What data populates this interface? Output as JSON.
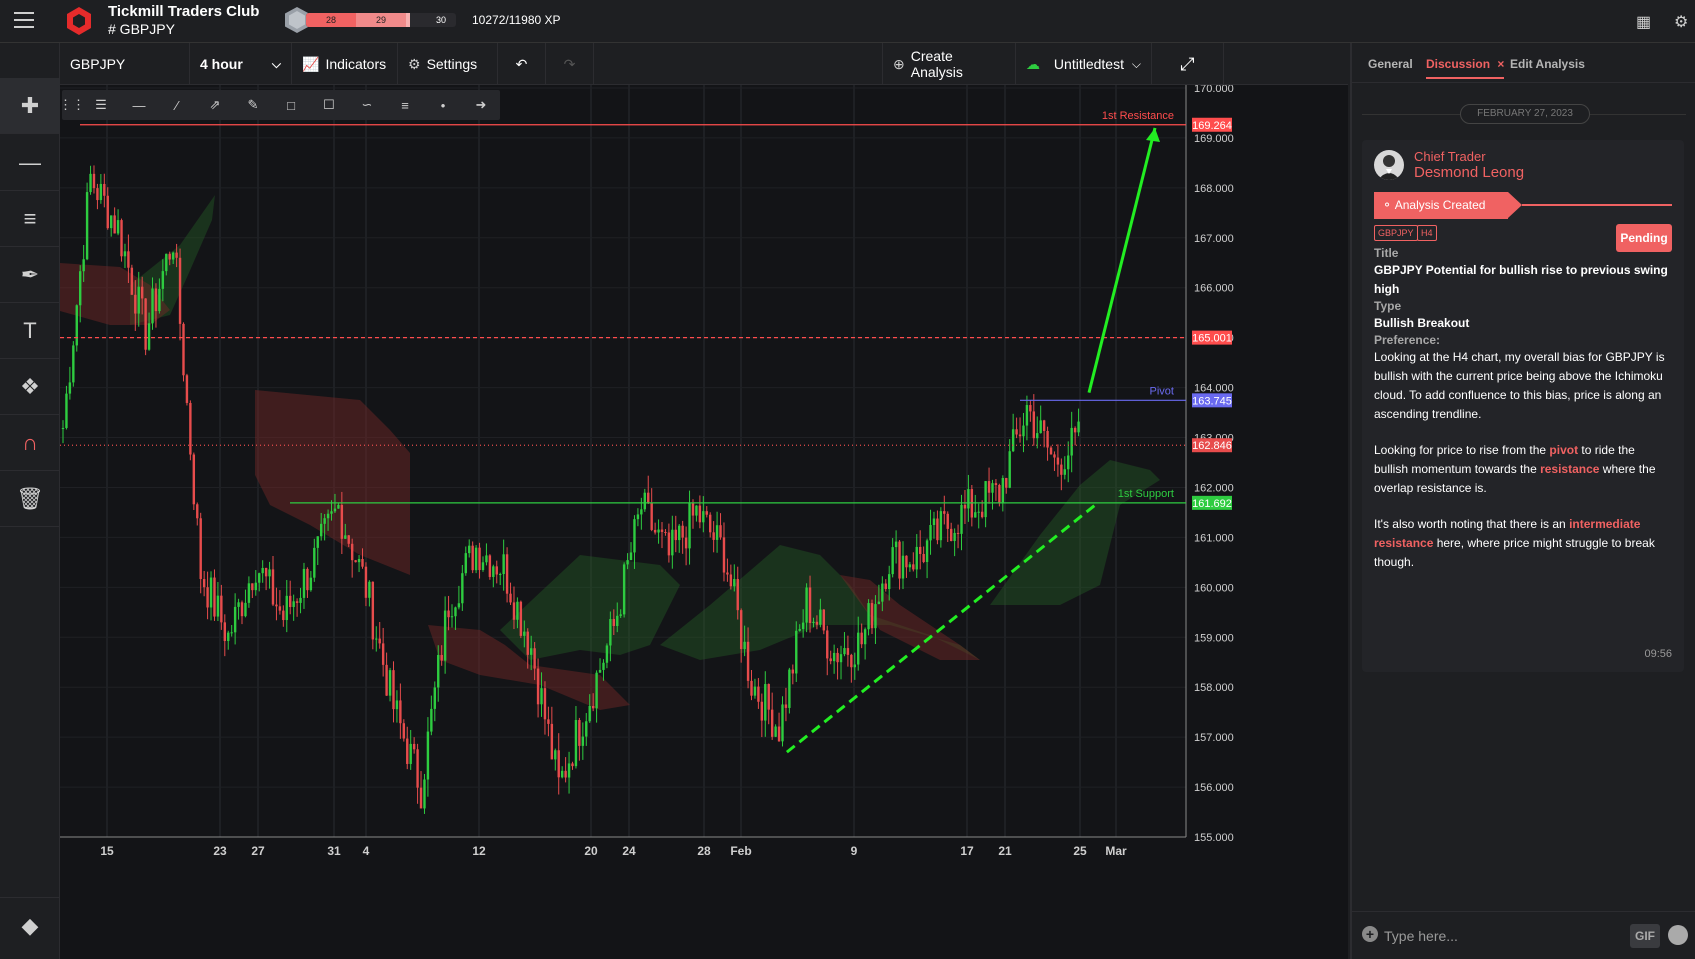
{
  "topbar": {
    "club_title": "Tickmill Traders Club",
    "club_sub": "# GBPJPY",
    "xp_seg1": "28",
    "xp_seg2": "29",
    "xp_seg3": "30",
    "xp_text": "10272/11980 XP",
    "xp_progress": 0.857
  },
  "chart_header": {
    "symbol": "GBPJPY",
    "interval": "4 hour",
    "indicators": "Indicators",
    "settings": "Settings",
    "create_analysis": "Create Analysis",
    "layout_name": "Untitledtest"
  },
  "chart_data": {
    "type": "candlestick",
    "symbol": "GBPJPY",
    "interval": "4 hour",
    "ylim": [
      155.0,
      170.0
    ],
    "y_ticks": [
      "170.000",
      "169.000",
      "168.000",
      "167.000",
      "166.000",
      "165.000",
      "164.000",
      "163.000",
      "162.000",
      "161.000",
      "160.000",
      "159.000",
      "158.000",
      "157.000",
      "156.000",
      "155.000"
    ],
    "x_ticks": [
      "15",
      "23",
      "27",
      "31",
      "4",
      "12",
      "20",
      "24",
      "28",
      "Feb",
      "9",
      "17",
      "21",
      "25",
      "Mar"
    ],
    "levels": [
      {
        "label": "1st Resistance",
        "value": "169.264",
        "color": "#ff4d4d",
        "style": "solid"
      },
      {
        "label": "",
        "value": "165.001",
        "color": "#ff4d4d",
        "style": "dashed"
      },
      {
        "label": "Pivot",
        "value": "163.745",
        "color": "#6a6af0",
        "style": "solid"
      },
      {
        "label": "",
        "value": "162.846",
        "color": "#e74c4c",
        "style": "dotted"
      },
      {
        "label": "1st Support",
        "value": "161.692",
        "color": "#2ecc40",
        "style": "solid"
      }
    ],
    "trendline": {
      "from": [
        0.51,
        156.7
      ],
      "to": [
        0.8,
        161.7
      ],
      "color": "#22ee22",
      "style": "dashed"
    },
    "arrow": {
      "from": 163.9,
      "to": 169.2,
      "color": "#22ee22"
    },
    "price_path": [
      163.2,
      168.2,
      167.2,
      165.1,
      167.0,
      160.3,
      159.0,
      160.5,
      159.4,
      160.4,
      161.6,
      160.0,
      157.6,
      156.0,
      159.7,
      160.8,
      160.4,
      158.8,
      156.0,
      157.6,
      159.2,
      161.6,
      160.6,
      161.5,
      160.7,
      158.1,
      157.2,
      159.7,
      158.7,
      158.9,
      160.6,
      160.6,
      161.2,
      161.6,
      161.9,
      163.6,
      162.5,
      163.0
    ]
  },
  "panel": {
    "tabs": [
      "General",
      "Discussion",
      "Edit Analysis"
    ],
    "date": "FEBRUARY 27, 2023",
    "role": "Chief Trader",
    "name": "Desmond Leong",
    "created": "Analysis Created",
    "tag1": "GBPJPY",
    "tag2": "H4",
    "status": "Pending",
    "title_label": "Title",
    "title_value": "GBPJPY Potential for bullish rise to previous swing high",
    "type_label": "Type",
    "type_value": "Bullish Breakout",
    "pref_label": "Preference:",
    "desc1": "Looking at the H4 chart, my overall bias for GBPJPY is bullish with the current price being above the Ichimoku cloud. To add confluence to this bias, price is along an ascending trendline.",
    "desc2_a": "Looking for price to rise from the ",
    "desc2_hl1": "pivot",
    "desc2_b": " to ride the bullish momentum towards the ",
    "desc2_hl2": "resistance",
    "desc2_c": " where the overlap resistance is.",
    "desc3_a": "It's also worth noting that there is an ",
    "desc3_hl": "intermediate resistance",
    "desc3_b": " here, where price might struggle to break though.",
    "time": "09:56",
    "input_placeholder": "Type here...",
    "gif": "GIF"
  }
}
